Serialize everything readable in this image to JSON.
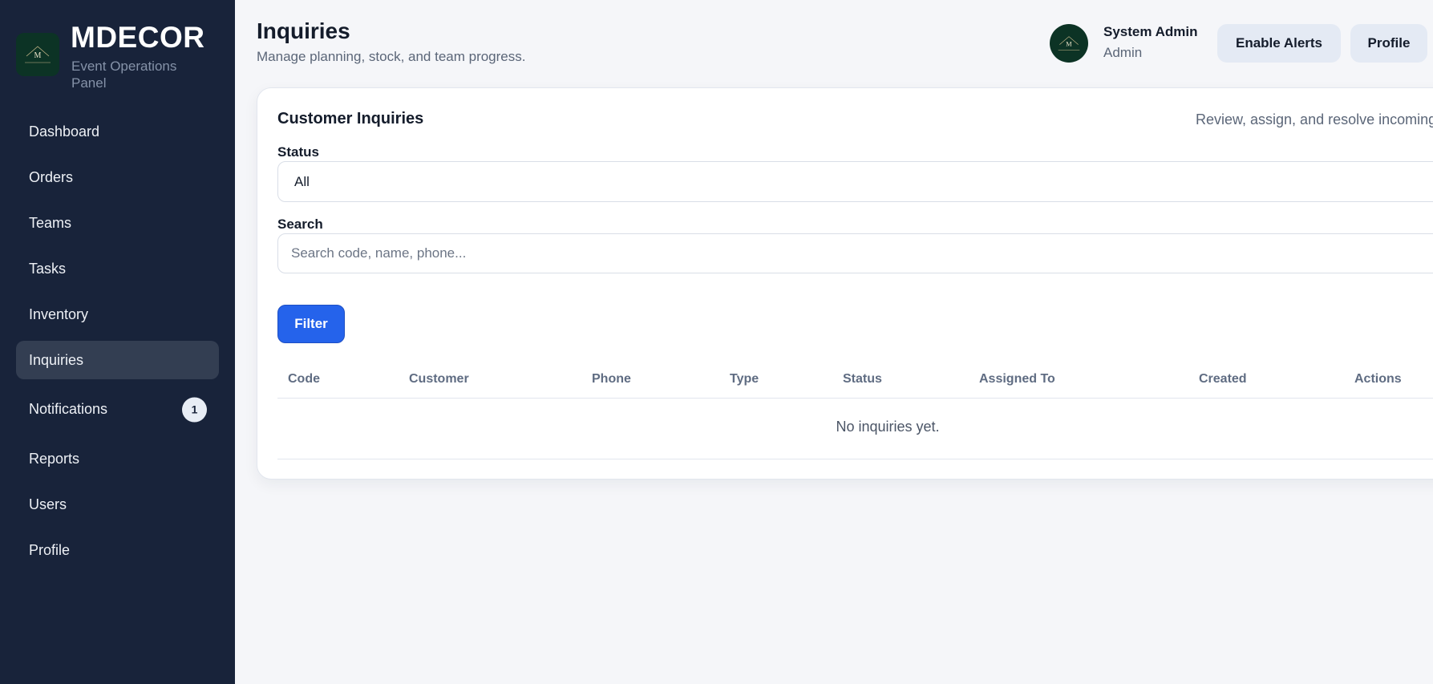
{
  "brand": {
    "title": "MDECOR",
    "subtitle": "Event Operations Panel",
    "logo_icon": "mdecor-logo-icon"
  },
  "sidebar": {
    "items": [
      {
        "label": "Dashboard",
        "active": false
      },
      {
        "label": "Orders",
        "active": false
      },
      {
        "label": "Teams",
        "active": false
      },
      {
        "label": "Tasks",
        "active": false
      },
      {
        "label": "Inventory",
        "active": false
      },
      {
        "label": "Inquiries",
        "active": true
      },
      {
        "label": "Notifications",
        "active": false,
        "badge": "1"
      },
      {
        "label": "Reports",
        "active": false
      },
      {
        "label": "Users",
        "active": false
      },
      {
        "label": "Profile",
        "active": false
      }
    ]
  },
  "header": {
    "title": "Inquiries",
    "subtitle": "Manage planning, stock, and team progress.",
    "user": {
      "name": "System Admin",
      "role": "Admin"
    },
    "buttons": {
      "alerts": "Enable Alerts",
      "profile": "Profile"
    }
  },
  "card": {
    "title": "Customer Inquiries",
    "description": "Review, assign, and resolve incoming",
    "status_label": "Status",
    "status_value": "All",
    "search_label": "Search",
    "search_placeholder": "Search code, name, phone...",
    "filter_button": "Filter",
    "columns": [
      "Code",
      "Customer",
      "Phone",
      "Type",
      "Status",
      "Assigned To",
      "Created",
      "Actions"
    ],
    "empty_message": "No inquiries yet."
  },
  "colors": {
    "sidebar_bg": "#18233a",
    "accent": "#2563eb",
    "active_nav": "#333e52",
    "logo_bg": "#0c3325"
  }
}
